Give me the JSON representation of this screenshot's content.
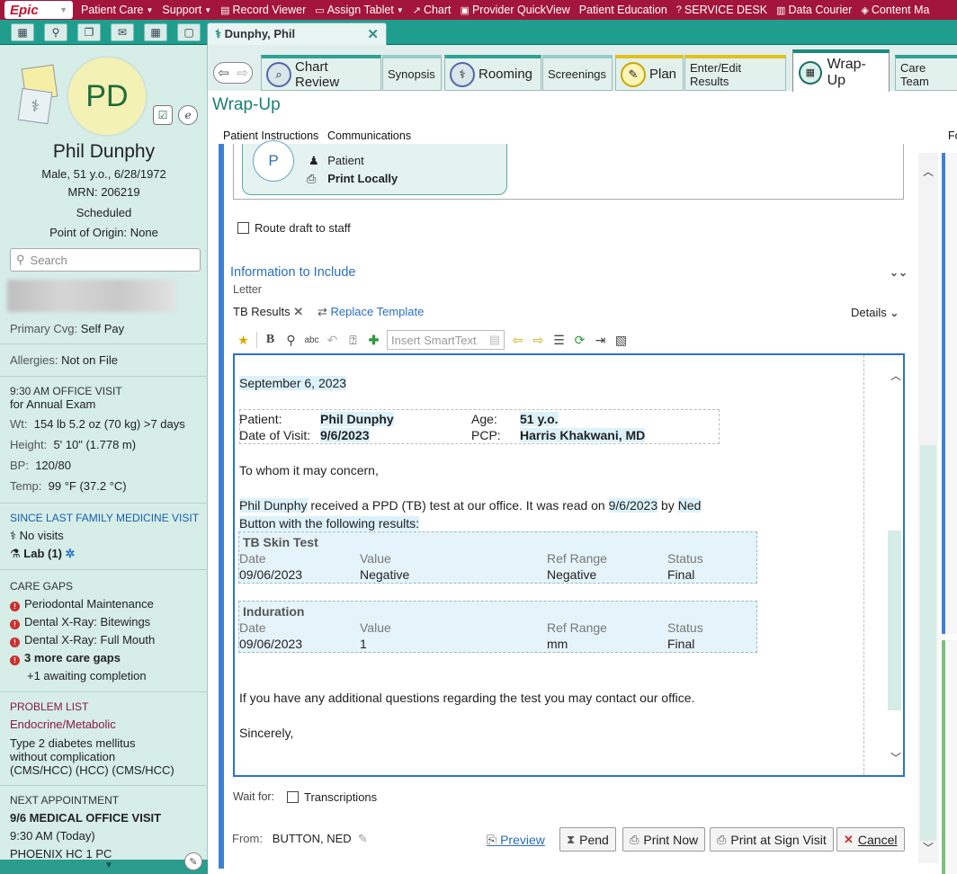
{
  "topbar": {
    "logo": "Epic",
    "items": [
      {
        "label": "Patient Care",
        "icon": "caret",
        "name": "patient-care"
      },
      {
        "label": "Support",
        "icon": "caret",
        "name": "support"
      },
      {
        "label": "Record Viewer",
        "icon": "record-viewer-icon",
        "name": "record-viewer"
      },
      {
        "label": "Assign Tablet",
        "icon": "tablet-icon",
        "name": "assign-tablet"
      },
      {
        "label": "Chart",
        "icon": "chart-icon",
        "name": "chart"
      },
      {
        "label": "Provider QuickView",
        "icon": "quickview-icon",
        "name": "provider-quickview"
      },
      {
        "label": "Patient Education",
        "icon": "",
        "name": "patient-education"
      },
      {
        "label": "SERVICE DESK",
        "icon": "help-icon",
        "name": "service-desk"
      },
      {
        "label": "Data Courier",
        "icon": "courier-icon",
        "name": "data-courier"
      },
      {
        "label": "Content Ma",
        "icon": "content-icon",
        "name": "content-management"
      }
    ]
  },
  "workspace_tab": {
    "label": "Dunphy, Phil",
    "close": "✕"
  },
  "patient": {
    "initials": "PD",
    "name": "Phil Dunphy",
    "demographics": "Male, 51 y.o., 6/28/1972",
    "mrn": "MRN: 206219",
    "status": "Scheduled",
    "origin_label": "Point of Origin:",
    "origin_value": "None",
    "search_placeholder": "Search",
    "coverage_label": "Primary Cvg:",
    "coverage_value": "Self Pay",
    "allergies_label": "Allergies:",
    "allergies_value": "Not on File"
  },
  "visit": {
    "header": "9:30 AM OFFICE VISIT",
    "reason": "for Annual Exam",
    "wt_label": "Wt:",
    "wt_value": "154 lb 5.2 oz (70 kg) >7 days",
    "height_label": "Height:",
    "height_value": "5' 10\" (1.778 m)",
    "bp_label": "BP:",
    "bp_value": "120/80",
    "temp_label": "Temp:",
    "temp_value": "99 °F (37.2 °C)"
  },
  "since_last": {
    "header": "SINCE LAST FAMILY MEDICINE VISIT",
    "no_visits": "No visits",
    "lab": "Lab (1)"
  },
  "care_gaps": {
    "header": "CARE GAPS",
    "items": [
      "Periodontal Maintenance",
      "Dental X-Ray: Bitewings",
      "Dental X-Ray: Full Mouth",
      "3 more care gaps"
    ],
    "awaiting": "+1 awaiting completion"
  },
  "problem_list": {
    "header": "PROBLEM LIST",
    "category": "Endocrine/Metabolic",
    "problem": [
      "Type 2 diabetes mellitus",
      "without complication",
      "(CMS/HCC) (HCC) (CMS/HCC)"
    ]
  },
  "next_appt": {
    "header": "NEXT APPOINTMENT",
    "title": "9/6 MEDICAL OFFICE VISIT",
    "time": "9:30 AM (Today)",
    "location": "PHOENIX HC 1 PC"
  },
  "activity_tabs": {
    "chart_review": "Chart Review",
    "synopsis": "Synopsis",
    "rooming": "Rooming",
    "screenings": "Screenings",
    "plan": "Plan",
    "enter_edit": "Enter/Edit Results",
    "wrap_up": "Wrap-Up",
    "care_team": "Care Team"
  },
  "main": {
    "title": "Wrap-Up",
    "subtabs": [
      "Patient Instructions",
      "Communications"
    ],
    "right_cut": "Fo",
    "recipient": {
      "initial": "P",
      "type": "Patient",
      "method": "Print Locally"
    },
    "route_draft": "Route draft to staff",
    "info_header": "Information to Include",
    "letter_label": "Letter",
    "template_name": "TB Results",
    "replace_template": "Replace Template",
    "details": "Details",
    "smarttext_placeholder": "Insert SmartText",
    "wait_for_label": "Wait for:",
    "transcriptions": "Transcriptions",
    "from_label": "From:",
    "from_value": "BUTTON, NED"
  },
  "letter": {
    "date": "September 6, 2023",
    "patient_label": "Patient:",
    "patient_value": "Phil Dunphy",
    "age_label": "Age:",
    "age_value": "51 y.o.",
    "dov_label": "Date of Visit:",
    "dov_value": "9/6/2023",
    "pcp_label": "PCP:",
    "pcp_value": "Harris Khakwani, MD",
    "salutation": "To whom it may concern,",
    "body_name": "Phil Dunphy",
    "body_mid": " received a PPD (TB) test at our office. It was read on ",
    "body_date": "9/6/2023",
    "body_by": " by ",
    "body_reader_1": "Ned",
    "body_line2": "Button with the following results:",
    "tb_table": {
      "title": "TB Skin Test",
      "headers": [
        "Date",
        "Value",
        "Ref Range",
        "Status"
      ],
      "row": [
        "09/06/2023",
        "Negative",
        "Negative",
        "Final"
      ]
    },
    "ind_table": {
      "title": "Induration",
      "headers": [
        "Date",
        "Value",
        "Ref Range",
        "Status"
      ],
      "row": [
        "09/06/2023",
        "1",
        "mm",
        "Final"
      ]
    },
    "closing_line": "If you have any additional questions regarding the test you may contact our office.",
    "signoff": "Sincerely,"
  },
  "footer": {
    "preview": "Preview",
    "pend": "Pend",
    "print_now": "Print Now",
    "print_at_sign": "Print at Sign Visit",
    "cancel": "Cancel"
  }
}
